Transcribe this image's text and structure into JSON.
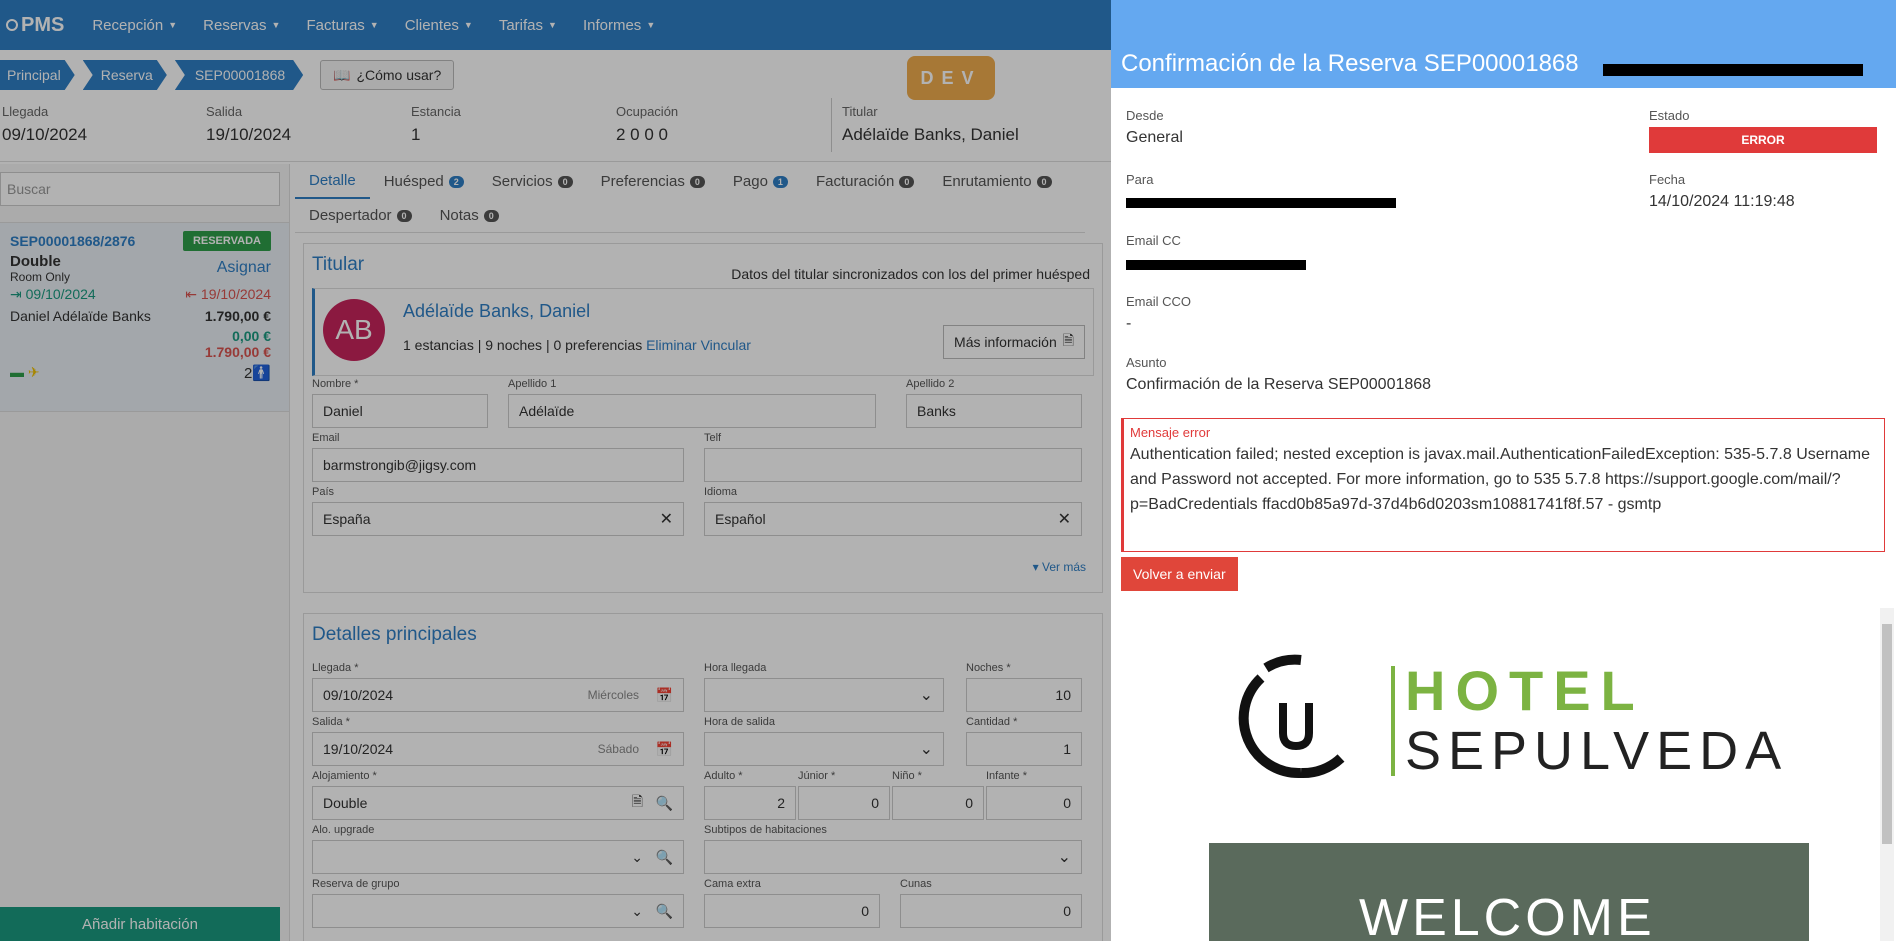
{
  "nav": {
    "brand": "PMS",
    "items": [
      "Recepción",
      "Reservas",
      "Facturas",
      "Clientes",
      "Tarifas",
      "Informes"
    ]
  },
  "breadcrumb": [
    "Principal",
    "Reserva",
    "SEP00001868"
  ],
  "how_to": "¿Cómo usar?",
  "env_badge": "DEV",
  "summary": {
    "arrival_label": "Llegada",
    "arrival": "09/10/2024",
    "departure_label": "Salida",
    "departure": "19/10/2024",
    "stay_label": "Estancia",
    "stay": "1",
    "occupancy_label": "Ocupación",
    "occupancy": "2 0 0 0",
    "holder_label": "Titular",
    "holder": "Adélaïde Banks, Daniel"
  },
  "sidebar": {
    "search_placeholder": "Buscar",
    "card": {
      "id": "SEP00001868/2876",
      "status": "RESERVADA",
      "room_type": "Double",
      "board": "Room Only",
      "assign": "Asignar",
      "arrival": "09/10/2024",
      "departure": "19/10/2024",
      "guest": "Daniel Adélaïde Banks",
      "total": "1.790,00 €",
      "paid": "0,00 €",
      "pending": "1.790,00 €",
      "pax": "2"
    },
    "add_room": "Añadir habitación"
  },
  "tabs": [
    {
      "label": "Detalle",
      "count": null
    },
    {
      "label": "Huésped",
      "count": "2"
    },
    {
      "label": "Servicios",
      "count": "0"
    },
    {
      "label": "Preferencias",
      "count": "0"
    },
    {
      "label": "Pago",
      "count": "1"
    },
    {
      "label": "Facturación",
      "count": "0"
    },
    {
      "label": "Enrutamiento",
      "count": "0"
    },
    {
      "label": "Despertador",
      "count": "0"
    },
    {
      "label": "Notas",
      "count": "0"
    }
  ],
  "holder_panel": {
    "title": "Titular",
    "sync_note": "Datos del titular sincronizados con los del primer huésped",
    "initials": "AB",
    "name": "Adélaïde Banks, Daniel",
    "info": "1 estancias | 9 noches | 0 preferencias",
    "delete_link": "Eliminar",
    "link_link": "Vincular",
    "more_info": "Más información",
    "fields": {
      "nombre_label": "Nombre *",
      "nombre": "Daniel",
      "apellido1_label": "Apellido 1",
      "apellido1": "Adélaïde",
      "apellido2_label": "Apellido 2",
      "apellido2": "Banks",
      "email_label": "Email",
      "email": "barmstrongib@jigsy.com",
      "telf_label": "Telf",
      "telf": "",
      "pais_label": "País",
      "pais": "España",
      "idioma_label": "Idioma",
      "idioma": "Español"
    },
    "see_more": "Ver más"
  },
  "details_panel": {
    "title": "Detalles principales",
    "llegada_label": "Llegada *",
    "llegada": "09/10/2024",
    "llegada_dow": "Miércoles",
    "hora_llegada_label": "Hora llegada",
    "noches_label": "Noches *",
    "noches": "10",
    "salida_label": "Salida *",
    "salida": "19/10/2024",
    "salida_dow": "Sábado",
    "hora_salida_label": "Hora de salida",
    "cantidad_label": "Cantidad *",
    "cantidad": "1",
    "alojamiento_label": "Alojamiento *",
    "alojamiento": "Double",
    "adulto_label": "Adulto *",
    "adulto": "2",
    "junior_label": "Júnior *",
    "junior": "0",
    "nino_label": "Niño *",
    "nino": "0",
    "infante_label": "Infante *",
    "infante": "0",
    "upgrade_label": "Alo. upgrade",
    "subtipos_label": "Subtipos de habitaciones",
    "grupo_label": "Reserva de grupo",
    "cama_label": "Cama extra",
    "cama": "0",
    "cunas_label": "Cunas",
    "cunas": "0"
  },
  "modal": {
    "title": "Confirmación de la Reserva SEP00001868",
    "desde_label": "Desde",
    "desde": "General",
    "estado_label": "Estado",
    "estado": "ERROR",
    "para_label": "Para",
    "fecha_label": "Fecha",
    "fecha": "14/10/2024 11:19:48",
    "cc_label": "Email CC",
    "cco_label": "Email CCO",
    "cco": "-",
    "asunto_label": "Asunto",
    "asunto": "Confirmación de la Reserva SEP00001868",
    "error_label": "Mensaje error",
    "error_message": "Authentication failed; nested exception is javax.mail.AuthenticationFailedException: 535-5.7.8 Username and Password not accepted. For more information, go to 535 5.7.8 https://support.google.com/mail/?p=BadCredentials ffacd0b85a97d-37d4b6d0203sm10881741f8f.57 - gsmtp",
    "resend": "Volver a enviar",
    "hotel_word": "HOTEL",
    "hotel_name": "SEPULVEDA",
    "welcome": "WELCOME"
  }
}
